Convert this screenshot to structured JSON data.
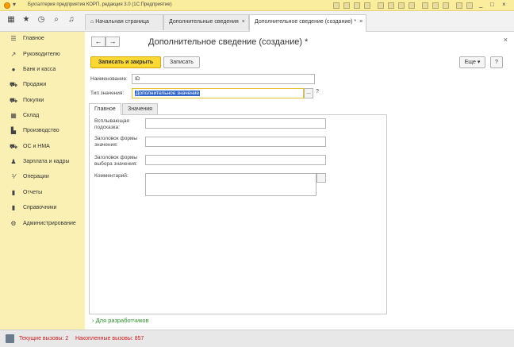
{
  "titlebar": {
    "title": "Бухгалтерия предприятия КОРП, редакция 3.0 (1С:Предприятие)",
    "menu_glyph": "▾",
    "buttons": {
      "minimize": "_",
      "restore": "□",
      "close": "×"
    }
  },
  "navbar": {
    "icons": {
      "apps": "▦",
      "favorites": "★",
      "history": "◷",
      "search": "⌕",
      "notifications": "♫"
    },
    "tabs": [
      {
        "label": "Начальная страница",
        "home_icon": "⌂"
      },
      {
        "label": "Дополнительные сведения",
        "close": "×"
      },
      {
        "label": "Дополнительное сведение (создание) *",
        "close": "×"
      }
    ]
  },
  "sidebar": {
    "items": [
      {
        "label": "Главное",
        "icon": "☰"
      },
      {
        "label": "Руководителю",
        "icon": "↗"
      },
      {
        "label": "Банк и касса",
        "icon": "●"
      },
      {
        "label": "Продажи",
        "icon": "⛟"
      },
      {
        "label": "Покупки",
        "icon": "⛟"
      },
      {
        "label": "Склад",
        "icon": "▦"
      },
      {
        "label": "Производство",
        "icon": "▙"
      },
      {
        "label": "ОС и НМА",
        "icon": "⛟"
      },
      {
        "label": "Зарплата и кадры",
        "icon": "♟"
      },
      {
        "label": "Операции",
        "icon": "⅟"
      },
      {
        "label": "Отчеты",
        "icon": "▮"
      },
      {
        "label": "Справочники",
        "icon": "▮"
      },
      {
        "label": "Администрирование",
        "icon": "⚙"
      }
    ]
  },
  "form": {
    "back": "←",
    "forward": "→",
    "title": "Дополнительное сведение (создание) *",
    "close": "×",
    "save_close_label": "Записать и закрыть",
    "save_label": "Записать",
    "more_label": "Еще ▾",
    "help_label": "?",
    "name_label": "Наименование:",
    "name_value": "ID",
    "type_label": "Тип значения:",
    "type_value": "Дополнительное значение",
    "type_dots": "...",
    "type_help": "?",
    "tabs": [
      "Главное",
      "Значения"
    ],
    "tooltip_label": "Всплывающая подсказка:",
    "header_label": "Заголовок формы значения:",
    "select_header_label": "Заголовок формы выбора значения:",
    "comment_label": "Комментарий:",
    "dev_link": "Для разработчиков",
    "dev_arrow": "›"
  },
  "status": {
    "current_calls": "Текущие вызовы: 2",
    "accumulated_calls": "Накопленные вызовы: 857"
  },
  "colors": {
    "sidebar_bg": "#fbf0b3",
    "titlebar_bg": "#fbed9e",
    "primary_button": "#fcd835",
    "status_text": "#c81e1e",
    "link": "#2e8b2e"
  }
}
